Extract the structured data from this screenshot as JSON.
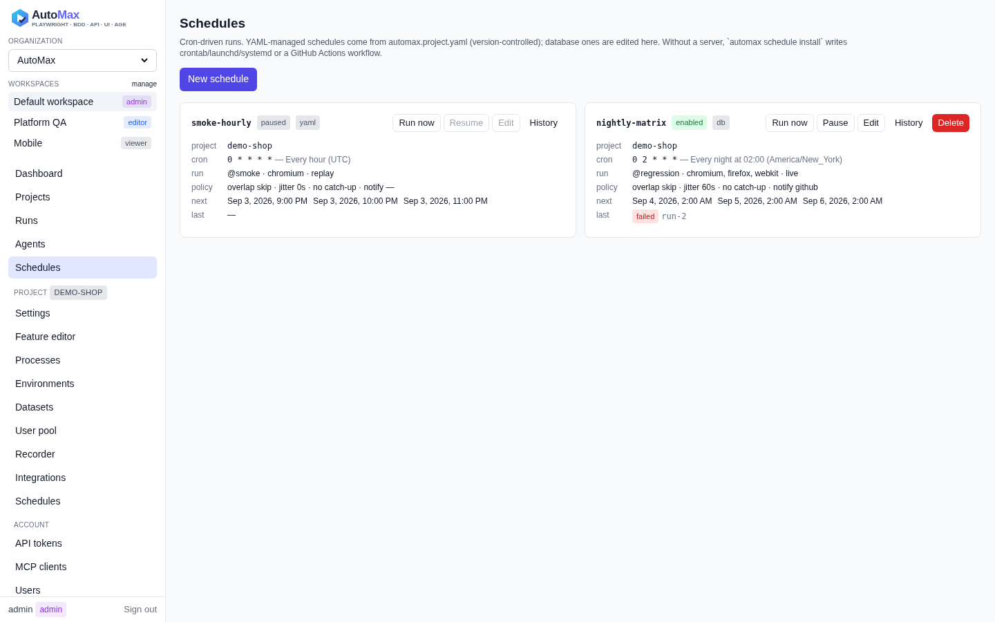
{
  "sidebar": {
    "logo": {
      "name_a": "Auto",
      "name_b": "Max",
      "tagline": "PLAYWRIGHT · BDD · API · UI · AGE"
    },
    "organization": {
      "label": "ORGANIZATION",
      "value": "AutoMax"
    },
    "workspaces": {
      "label": "WORKSPACES",
      "manage": "manage",
      "items": [
        {
          "name": "Default workspace",
          "role": "admin",
          "color": "#9333ea",
          "selected": true
        },
        {
          "name": "Platform QA",
          "role": "editor",
          "color": "#2563eb",
          "selected": false
        },
        {
          "name": "Mobile",
          "role": "viewer",
          "color": "#4b5563",
          "selected": false
        }
      ]
    },
    "nav": [
      {
        "items": [
          {
            "label": "Dashboard",
            "selected": false
          },
          {
            "label": "Projects",
            "selected": false
          },
          {
            "label": "Runs",
            "selected": false
          },
          {
            "label": "Agents",
            "selected": false
          },
          {
            "label": "Schedules",
            "selected": true
          }
        ]
      },
      {
        "heading": "PROJECT",
        "tag": "DEMO-SHOP",
        "items": [
          {
            "label": "Settings",
            "selected": false
          },
          {
            "label": "Feature editor",
            "selected": false
          },
          {
            "label": "Processes",
            "selected": false
          },
          {
            "label": "Environments",
            "selected": false
          },
          {
            "label": "Datasets",
            "selected": false
          },
          {
            "label": "User pool",
            "selected": false
          },
          {
            "label": "Recorder",
            "selected": false
          },
          {
            "label": "Integrations",
            "selected": false
          },
          {
            "label": "Schedules",
            "selected": false
          }
        ]
      },
      {
        "heading": "ACCOUNT",
        "items": [
          {
            "label": "API tokens",
            "selected": false
          },
          {
            "label": "MCP clients",
            "selected": false
          },
          {
            "label": "Users",
            "selected": false
          }
        ]
      }
    ],
    "footer": {
      "user": "admin",
      "role": "admin",
      "sign_out": "Sign out"
    }
  },
  "main": {
    "title": "Schedules",
    "description": "Cron-driven runs. YAML-managed schedules come from automax.project.yaml (version-controlled); database ones are edited here. Without a server, `automax schedule install` writes crontab/launchd/systemd or a GitHub Actions workflow.",
    "new_button": "New schedule",
    "schedules": [
      {
        "name": "smoke-hourly",
        "status": {
          "text": "paused",
          "kind": "paused"
        },
        "source": "yaml",
        "buttons": [
          {
            "label": "Run now",
            "kind": "outline",
            "disabled": false
          },
          {
            "label": "Resume",
            "kind": "outline",
            "disabled": true
          },
          {
            "label": "Edit",
            "kind": "outline",
            "disabled": true
          },
          {
            "label": "History",
            "kind": "link",
            "disabled": false
          }
        ],
        "fields": [
          {
            "label": "project",
            "kind": "mono",
            "value": "demo-shop"
          },
          {
            "label": "cron",
            "kind": "cron",
            "expr": "0 * * * *",
            "description": "— Every hour (UTC)"
          },
          {
            "label": "run",
            "kind": "text",
            "value": "@smoke · chromium · replay"
          },
          {
            "label": "policy",
            "kind": "text",
            "value": "overlap skip · jitter 0s · no catch-up · notify —"
          },
          {
            "label": "next",
            "kind": "times",
            "values": [
              "Sep 3, 2026, 9:00 PM",
              "Sep 3, 2026, 10:00 PM",
              "Sep 3, 2026, 11:00 PM"
            ]
          },
          {
            "label": "last",
            "kind": "text",
            "value": "—"
          }
        ]
      },
      {
        "name": "nightly-matrix",
        "status": {
          "text": "enabled",
          "kind": "enabled"
        },
        "source": "db",
        "buttons": [
          {
            "label": "Run now",
            "kind": "outline",
            "disabled": false
          },
          {
            "label": "Pause",
            "kind": "outline",
            "disabled": false
          },
          {
            "label": "Edit",
            "kind": "outline",
            "disabled": false
          },
          {
            "label": "History",
            "kind": "link",
            "disabled": false
          },
          {
            "label": "Delete",
            "kind": "danger",
            "disabled": false
          }
        ],
        "fields": [
          {
            "label": "project",
            "kind": "mono",
            "value": "demo-shop"
          },
          {
            "label": "cron",
            "kind": "cron",
            "expr": "0 2 * * *",
            "description": "— Every night at 02:00 (America/New_York)"
          },
          {
            "label": "run",
            "kind": "text",
            "value": "@regression · chromium, firefox, webkit · live"
          },
          {
            "label": "policy",
            "kind": "text",
            "value": "overlap skip · jitter 60s · no catch-up · notify github"
          },
          {
            "label": "next",
            "kind": "times",
            "values": [
              "Sep 4, 2026, 2:00 AM",
              "Sep 5, 2026, 2:00 AM",
              "Sep 6, 2026, 2:00 AM"
            ]
          },
          {
            "label": "last",
            "kind": "result",
            "badge": "failed",
            "run": "run-2"
          }
        ]
      }
    ]
  }
}
